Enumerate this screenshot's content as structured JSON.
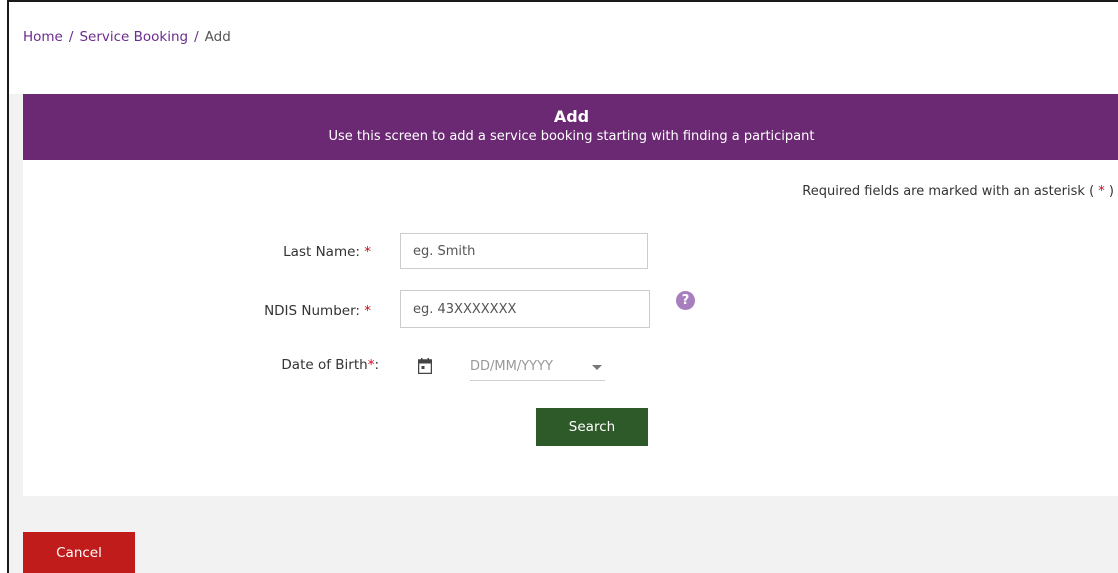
{
  "breadcrumb": {
    "home": "Home",
    "separator": "/",
    "service_booking": "Service Booking",
    "current": "Add"
  },
  "header": {
    "title": "Add",
    "subtitle": "Use this screen to add a service booking starting with finding a participant"
  },
  "form": {
    "required_note_prefix": "Required fields are marked with an asterisk (",
    "required_note_star": "*",
    "required_note_suffix": ")",
    "last_name": {
      "label": "Last Name:",
      "star": "*",
      "placeholder": "eg. Smith",
      "value": ""
    },
    "ndis_number": {
      "label": "NDIS Number:",
      "star": "*",
      "placeholder": "eg. 43XXXXXXX",
      "value": "",
      "help_icon": "?"
    },
    "date_of_birth": {
      "label": "Date of Birth",
      "star": "*",
      "colon": ":",
      "placeholder": "DD/MM/YYYY",
      "icon": "calendar-icon"
    },
    "search_label": "Search"
  },
  "footer": {
    "cancel_label": "Cancel"
  },
  "colors": {
    "header_purple": "#6b2973",
    "link_purple": "#6b2c8f",
    "search_green": "#2e5a2a",
    "cancel_red": "#c01c1c",
    "required_red": "#d0021b",
    "help_purple": "#a77fbf"
  }
}
